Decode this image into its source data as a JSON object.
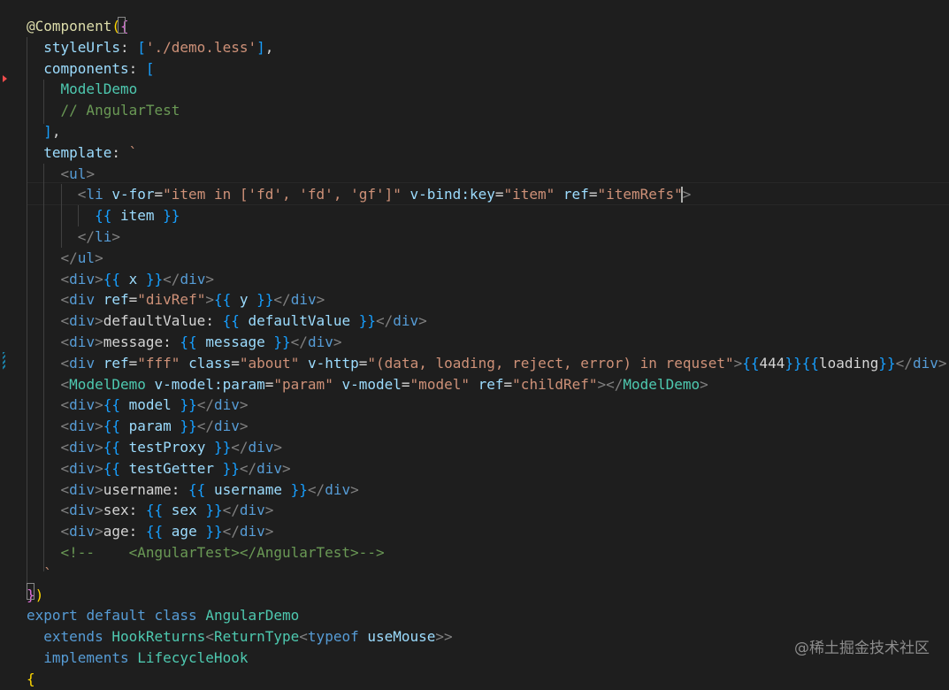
{
  "editor": {
    "colors": {
      "background": "#1e1e1e",
      "decorator": "#dcdcaa",
      "property": "#9cdcfe",
      "string": "#ce9178",
      "class_type": "#4ec9b0",
      "comment": "#6a9955",
      "keyword": "#569cd6",
      "bracket_gold": "#ffd700",
      "bracket_purple": "#da70d6",
      "bracket_blue": "#179fff"
    },
    "lines": [
      [
        [
          "c-deco",
          "@Component"
        ],
        [
          "c-bracket1",
          "("
        ],
        [
          "c-bracket2",
          "{"
        ]
      ],
      [
        [
          "c-plain",
          "  "
        ],
        [
          "c-prop",
          "styleUrls"
        ],
        [
          "c-plain",
          ": "
        ],
        [
          "c-bracket3",
          "["
        ],
        [
          "c-str",
          "'./demo.less'"
        ],
        [
          "c-bracket3",
          "]"
        ],
        [
          "c-plain",
          ","
        ]
      ],
      [
        [
          "c-plain",
          "  "
        ],
        [
          "c-prop",
          "components"
        ],
        [
          "c-plain",
          ": "
        ],
        [
          "c-bracket3",
          "["
        ]
      ],
      [
        [
          "c-plain",
          "    "
        ],
        [
          "c-type",
          "ModelDemo"
        ]
      ],
      [
        [
          "c-plain",
          "    "
        ],
        [
          "c-comment",
          "// AngularTest"
        ]
      ],
      [
        [
          "c-plain",
          "  "
        ],
        [
          "c-bracket3",
          "]"
        ],
        [
          "c-plain",
          ","
        ]
      ],
      [
        [
          "c-plain",
          "  "
        ],
        [
          "c-prop",
          "template"
        ],
        [
          "c-plain",
          ": "
        ],
        [
          "c-str",
          "`"
        ]
      ],
      [
        [
          "c-plain",
          "    "
        ],
        [
          "c-punct",
          "<"
        ],
        [
          "c-tag",
          "ul"
        ],
        [
          "c-punct",
          ">"
        ]
      ],
      [
        [
          "c-plain",
          "      "
        ],
        [
          "c-punct",
          "<"
        ],
        [
          "c-tag",
          "li"
        ],
        [
          "c-plain",
          " "
        ],
        [
          "c-attr",
          "v-for"
        ],
        [
          "c-plain",
          "="
        ],
        [
          "c-str",
          "\"item in ['fd', 'fd', 'gf']\""
        ],
        [
          "c-plain",
          " "
        ],
        [
          "c-attr",
          "v-bind:key"
        ],
        [
          "c-plain",
          "="
        ],
        [
          "c-str",
          "\"item\""
        ],
        [
          "c-plain",
          " "
        ],
        [
          "c-attr",
          "ref"
        ],
        [
          "c-plain",
          "="
        ],
        [
          "c-str",
          "\"itemRefs\""
        ],
        [
          "c-punct",
          ">"
        ]
      ],
      [
        [
          "c-plain",
          "        "
        ],
        [
          "c-bracket3",
          "{{"
        ],
        [
          "c-plain",
          " "
        ],
        [
          "c-prop",
          "item"
        ],
        [
          "c-plain",
          " "
        ],
        [
          "c-bracket3",
          "}}"
        ]
      ],
      [
        [
          "c-plain",
          "      "
        ],
        [
          "c-punct",
          "</"
        ],
        [
          "c-tag",
          "li"
        ],
        [
          "c-punct",
          ">"
        ]
      ],
      [
        [
          "c-plain",
          "    "
        ],
        [
          "c-punct",
          "</"
        ],
        [
          "c-tag",
          "ul"
        ],
        [
          "c-punct",
          ">"
        ]
      ],
      [
        [
          "c-plain",
          "    "
        ],
        [
          "c-punct",
          "<"
        ],
        [
          "c-tag",
          "div"
        ],
        [
          "c-punct",
          ">"
        ],
        [
          "c-bracket3",
          "{{"
        ],
        [
          "c-plain",
          " "
        ],
        [
          "c-prop",
          "x"
        ],
        [
          "c-plain",
          " "
        ],
        [
          "c-bracket3",
          "}}"
        ],
        [
          "c-punct",
          "</"
        ],
        [
          "c-tag",
          "div"
        ],
        [
          "c-punct",
          ">"
        ]
      ],
      [
        [
          "c-plain",
          "    "
        ],
        [
          "c-punct",
          "<"
        ],
        [
          "c-tag",
          "div"
        ],
        [
          "c-plain",
          " "
        ],
        [
          "c-attr",
          "ref"
        ],
        [
          "c-plain",
          "="
        ],
        [
          "c-str",
          "\"divRef\""
        ],
        [
          "c-punct",
          ">"
        ],
        [
          "c-bracket3",
          "{{"
        ],
        [
          "c-plain",
          " "
        ],
        [
          "c-prop",
          "y"
        ],
        [
          "c-plain",
          " "
        ],
        [
          "c-bracket3",
          "}}"
        ],
        [
          "c-punct",
          "</"
        ],
        [
          "c-tag",
          "div"
        ],
        [
          "c-punct",
          ">"
        ]
      ],
      [
        [
          "c-plain",
          "    "
        ],
        [
          "c-punct",
          "<"
        ],
        [
          "c-tag",
          "div"
        ],
        [
          "c-punct",
          ">"
        ],
        [
          "c-plain",
          "defaultValue: "
        ],
        [
          "c-bracket3",
          "{{"
        ],
        [
          "c-plain",
          " "
        ],
        [
          "c-prop",
          "defaultValue"
        ],
        [
          "c-plain",
          " "
        ],
        [
          "c-bracket3",
          "}}"
        ],
        [
          "c-punct",
          "</"
        ],
        [
          "c-tag",
          "div"
        ],
        [
          "c-punct",
          ">"
        ]
      ],
      [
        [
          "c-plain",
          "    "
        ],
        [
          "c-punct",
          "<"
        ],
        [
          "c-tag",
          "div"
        ],
        [
          "c-punct",
          ">"
        ],
        [
          "c-plain",
          "message: "
        ],
        [
          "c-bracket3",
          "{{"
        ],
        [
          "c-plain",
          " "
        ],
        [
          "c-prop",
          "message"
        ],
        [
          "c-plain",
          " "
        ],
        [
          "c-bracket3",
          "}}"
        ],
        [
          "c-punct",
          "</"
        ],
        [
          "c-tag",
          "div"
        ],
        [
          "c-punct",
          ">"
        ]
      ],
      [
        [
          "c-plain",
          "    "
        ],
        [
          "c-punct",
          "<"
        ],
        [
          "c-tag",
          "div"
        ],
        [
          "c-plain",
          " "
        ],
        [
          "c-attr",
          "ref"
        ],
        [
          "c-plain",
          "="
        ],
        [
          "c-str",
          "\"fff\""
        ],
        [
          "c-plain",
          " "
        ],
        [
          "c-attr",
          "class"
        ],
        [
          "c-plain",
          "="
        ],
        [
          "c-str",
          "\"about\""
        ],
        [
          "c-plain",
          " "
        ],
        [
          "c-attr",
          "v-http"
        ],
        [
          "c-plain",
          "="
        ],
        [
          "c-str",
          "\"(data, loading, reject, error) in requset\""
        ],
        [
          "c-punct",
          ">"
        ],
        [
          "c-bracket3",
          "{{"
        ],
        [
          "c-plain",
          "444"
        ],
        [
          "c-bracket3",
          "}}{{"
        ],
        [
          "c-plain",
          "loading"
        ],
        [
          "c-bracket3",
          "}}"
        ],
        [
          "c-punct",
          "</"
        ],
        [
          "c-tag",
          "div"
        ],
        [
          "c-punct",
          ">"
        ]
      ],
      [
        [
          "c-plain",
          "    "
        ],
        [
          "c-punct",
          "<"
        ],
        [
          "c-type",
          "ModelDemo"
        ],
        [
          "c-plain",
          " "
        ],
        [
          "c-attr",
          "v-model:param"
        ],
        [
          "c-plain",
          "="
        ],
        [
          "c-str",
          "\"param\""
        ],
        [
          "c-plain",
          " "
        ],
        [
          "c-attr",
          "v-model"
        ],
        [
          "c-plain",
          "="
        ],
        [
          "c-str",
          "\"model\""
        ],
        [
          "c-plain",
          " "
        ],
        [
          "c-attr",
          "ref"
        ],
        [
          "c-plain",
          "="
        ],
        [
          "c-str",
          "\"childRef\""
        ],
        [
          "c-punct",
          "></"
        ],
        [
          "c-type",
          "ModelDemo"
        ],
        [
          "c-punct",
          ">"
        ]
      ],
      [
        [
          "c-plain",
          "    "
        ],
        [
          "c-punct",
          "<"
        ],
        [
          "c-tag",
          "div"
        ],
        [
          "c-punct",
          ">"
        ],
        [
          "c-bracket3",
          "{{"
        ],
        [
          "c-plain",
          " "
        ],
        [
          "c-prop",
          "model"
        ],
        [
          "c-plain",
          " "
        ],
        [
          "c-bracket3",
          "}}"
        ],
        [
          "c-punct",
          "</"
        ],
        [
          "c-tag",
          "div"
        ],
        [
          "c-punct",
          ">"
        ]
      ],
      [
        [
          "c-plain",
          "    "
        ],
        [
          "c-punct",
          "<"
        ],
        [
          "c-tag",
          "div"
        ],
        [
          "c-punct",
          ">"
        ],
        [
          "c-bracket3",
          "{{"
        ],
        [
          "c-plain",
          " "
        ],
        [
          "c-prop",
          "param"
        ],
        [
          "c-plain",
          " "
        ],
        [
          "c-bracket3",
          "}}"
        ],
        [
          "c-punct",
          "</"
        ],
        [
          "c-tag",
          "div"
        ],
        [
          "c-punct",
          ">"
        ]
      ],
      [
        [
          "c-plain",
          "    "
        ],
        [
          "c-punct",
          "<"
        ],
        [
          "c-tag",
          "div"
        ],
        [
          "c-punct",
          ">"
        ],
        [
          "c-bracket3",
          "{{"
        ],
        [
          "c-plain",
          " "
        ],
        [
          "c-prop",
          "testProxy"
        ],
        [
          "c-plain",
          " "
        ],
        [
          "c-bracket3",
          "}}"
        ],
        [
          "c-punct",
          "</"
        ],
        [
          "c-tag",
          "div"
        ],
        [
          "c-punct",
          ">"
        ]
      ],
      [
        [
          "c-plain",
          "    "
        ],
        [
          "c-punct",
          "<"
        ],
        [
          "c-tag",
          "div"
        ],
        [
          "c-punct",
          ">"
        ],
        [
          "c-bracket3",
          "{{"
        ],
        [
          "c-plain",
          " "
        ],
        [
          "c-prop",
          "testGetter"
        ],
        [
          "c-plain",
          " "
        ],
        [
          "c-bracket3",
          "}}"
        ],
        [
          "c-punct",
          "</"
        ],
        [
          "c-tag",
          "div"
        ],
        [
          "c-punct",
          ">"
        ]
      ],
      [
        [
          "c-plain",
          "    "
        ],
        [
          "c-punct",
          "<"
        ],
        [
          "c-tag",
          "div"
        ],
        [
          "c-punct",
          ">"
        ],
        [
          "c-plain",
          "username: "
        ],
        [
          "c-bracket3",
          "{{"
        ],
        [
          "c-plain",
          " "
        ],
        [
          "c-prop",
          "username"
        ],
        [
          "c-plain",
          " "
        ],
        [
          "c-bracket3",
          "}}"
        ],
        [
          "c-punct",
          "</"
        ],
        [
          "c-tag",
          "div"
        ],
        [
          "c-punct",
          ">"
        ]
      ],
      [
        [
          "c-plain",
          "    "
        ],
        [
          "c-punct",
          "<"
        ],
        [
          "c-tag",
          "div"
        ],
        [
          "c-punct",
          ">"
        ],
        [
          "c-plain",
          "sex: "
        ],
        [
          "c-bracket3",
          "{{"
        ],
        [
          "c-plain",
          " "
        ],
        [
          "c-prop",
          "sex"
        ],
        [
          "c-plain",
          " "
        ],
        [
          "c-bracket3",
          "}}"
        ],
        [
          "c-punct",
          "</"
        ],
        [
          "c-tag",
          "div"
        ],
        [
          "c-punct",
          ">"
        ]
      ],
      [
        [
          "c-plain",
          "    "
        ],
        [
          "c-punct",
          "<"
        ],
        [
          "c-tag",
          "div"
        ],
        [
          "c-punct",
          ">"
        ],
        [
          "c-plain",
          "age: "
        ],
        [
          "c-bracket3",
          "{{"
        ],
        [
          "c-plain",
          " "
        ],
        [
          "c-prop",
          "age"
        ],
        [
          "c-plain",
          " "
        ],
        [
          "c-bracket3",
          "}}"
        ],
        [
          "c-punct",
          "</"
        ],
        [
          "c-tag",
          "div"
        ],
        [
          "c-punct",
          ">"
        ]
      ],
      [
        [
          "c-plain",
          "    "
        ],
        [
          "c-comment",
          "<!--    <AngularTest></AngularTest>-->"
        ]
      ],
      [
        [
          "c-plain",
          "  "
        ],
        [
          "c-str",
          "`"
        ]
      ],
      [
        [
          "c-bracket2",
          "}"
        ],
        [
          "c-bracket1",
          ")"
        ]
      ],
      [
        [
          "c-keyword",
          "export"
        ],
        [
          "c-plain",
          " "
        ],
        [
          "c-keyword",
          "default"
        ],
        [
          "c-plain",
          " "
        ],
        [
          "c-keyword",
          "class"
        ],
        [
          "c-plain",
          " "
        ],
        [
          "c-type",
          "AngularDemo"
        ]
      ],
      [
        [
          "c-plain",
          "  "
        ],
        [
          "c-keyword",
          "extends"
        ],
        [
          "c-plain",
          " "
        ],
        [
          "c-type",
          "HookReturns"
        ],
        [
          "c-punct",
          "<"
        ],
        [
          "c-type",
          "ReturnType"
        ],
        [
          "c-punct",
          "<"
        ],
        [
          "c-keyword",
          "typeof"
        ],
        [
          "c-plain",
          " "
        ],
        [
          "c-prop",
          "useMouse"
        ],
        [
          "c-punct",
          ">>"
        ]
      ],
      [
        [
          "c-plain",
          "  "
        ],
        [
          "c-keyword",
          "implements"
        ],
        [
          "c-plain",
          " "
        ],
        [
          "c-type",
          "LifecycleHook"
        ]
      ],
      [
        [
          "c-bracket1",
          "{"
        ]
      ]
    ]
  },
  "watermark": "@稀土掘金技术社区"
}
